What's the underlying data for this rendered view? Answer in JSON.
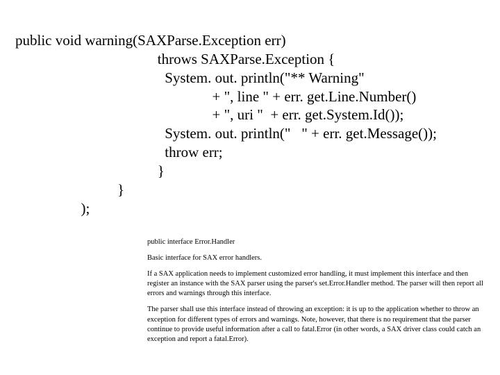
{
  "code": {
    "l1": "public void warning(SAXParse.Exception err)",
    "l2": "                                       throws SAXParse.Exception {",
    "l3": "                                         System. out. println(\"** Warning\"",
    "l4": "                                                      + \", line \" + err. get.Line.Number()",
    "l5": "                                                      + \", uri \"  + err. get.System.Id());",
    "l6": "                                         System. out. println(\"   \" + err. get.Message());",
    "l7": "                                         throw err;",
    "l8": "                                       }",
    "l9": "                            }",
    "l10": "                  );"
  },
  "explain": {
    "p1": "public interface Error.Handler",
    "p2": "Basic interface for SAX error handlers.",
    "p3": "If a SAX application needs to implement customized error handling, it must implement this interface and then register an instance with the SAX parser using the parser's set.Error.Handler method. The parser will then report all errors and warnings through this interface.",
    "p4": "The parser shall use this interface instead of throwing an exception: it is up to the application whether to throw an exception for different types of errors and warnings. Note, however, that there is no requirement that the parser continue to provide useful information after a call to fatal.Error (in other words, a SAX driver class could catch an exception and report a fatal.Error)."
  }
}
